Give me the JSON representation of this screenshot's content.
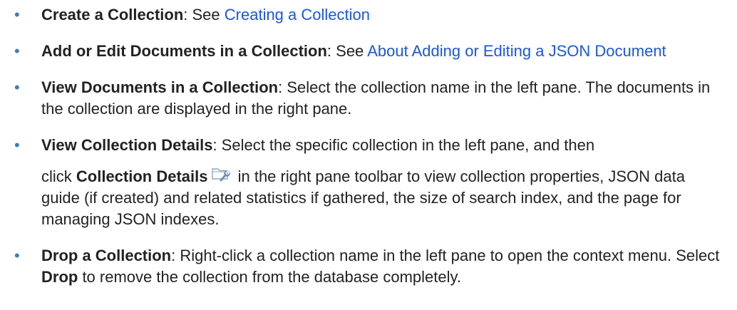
{
  "items": [
    {
      "term": "Create a Collection",
      "sep": ": See ",
      "link": "Creating a Collection"
    },
    {
      "term": "Add or Edit Documents in a Collection",
      "sep": ": See ",
      "link": "About Adding or Editing a JSON Document"
    },
    {
      "term": "View Documents in a Collection",
      "text": ": Select the collection name in the left pane. The documents in the collection are displayed in the right pane."
    },
    {
      "term": "View Collection Details",
      "text1": ": Select the specific collection in the left pane, and then",
      "text2": "click ",
      "term2": "Collection Details",
      "icon": "collection-details-icon",
      "text3": " in the right pane toolbar to view collection properties, JSON data guide (if created) and related statistics if gathered, the size of search index, and the page for managing JSON indexes."
    },
    {
      "term": "Drop a Collection",
      "text1": ": Right-click a collection name in the left pane to open the context menu. Select ",
      "term2": "Drop",
      "text2": " to remove the collection from the database completely."
    }
  ],
  "bullet": "•",
  "colors": {
    "bullet": "#3b7fb8",
    "link": "#1c57d8",
    "text": "#222222"
  }
}
